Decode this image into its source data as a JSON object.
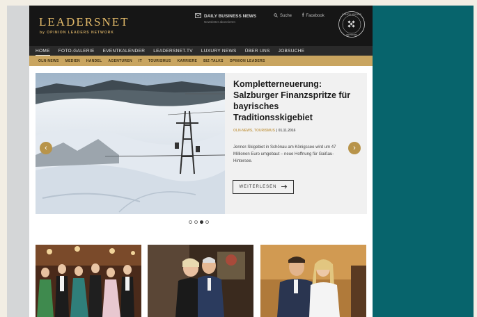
{
  "site": {
    "logo": "LEADERSNET",
    "logo_sub": "by OPINION LEADERS NETWORK",
    "daily_news": "DAILY BUSINESS NEWS",
    "daily_news_sub": "Newsletter abonnieren",
    "search_label": "Suche",
    "facebook_label": "Facebook",
    "seal_text": "OPINION LEADERS NETWORK"
  },
  "main_nav": [
    "HOME",
    "FOTO-GALERIE",
    "EVENTKALENDER",
    "LEADERSNET.TV",
    "LUXURY NEWS",
    "ÜBER UNS",
    "JOBSUCHE"
  ],
  "sub_nav": [
    "OLN-NEWS",
    "MEDIEN",
    "HANDEL",
    "AGENTUREN",
    "IT",
    "TOURISMUS",
    "KARRIERE",
    "BIZ-TALKS",
    "OPINION LEADERS"
  ],
  "hero": {
    "headline": "Kompletterneuerung: Salzburger Finanzspritze für bayrisches Traditionsskigebiet",
    "categories": "OLN-NEWS, TOURISMUS",
    "date": "| 01.11.2016",
    "teaser": "Jenner-Skigebiet in Schönau am Königssee wird um 47 Millionen Euro umgebaut – neue Hoffnung für Gaißau-Hintersee.",
    "read_more": "WEITERLESEN"
  },
  "slider": {
    "count": 4,
    "active_index": 2
  },
  "colors": {
    "accent": "#c9a560",
    "frame": "#07646c",
    "header": "#161616"
  },
  "icons": {
    "prev": "chevron-left-icon",
    "next": "chevron-right-icon",
    "newsletter": "mail-icon",
    "search": "search-icon",
    "facebook": "facebook-icon"
  }
}
